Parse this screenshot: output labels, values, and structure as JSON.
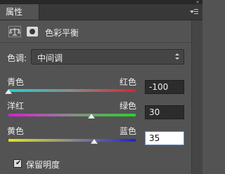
{
  "panel": {
    "tab_label": "属性",
    "collapse_glyph": "«"
  },
  "header": {
    "title": "色彩平衡",
    "adjustment_icon": "balance-scale-icon",
    "mask_icon": "layer-mask-icon"
  },
  "tone": {
    "label": "色调:",
    "value": "中间调"
  },
  "sliders": [
    {
      "left_label": "青色",
      "right_label": "红色",
      "value": "-100",
      "level": -100
    },
    {
      "left_label": "洋红",
      "right_label": "绿色",
      "value": "30",
      "level": 30
    },
    {
      "left_label": "黄色",
      "right_label": "蓝色",
      "value": "35",
      "level": 35
    }
  ],
  "preserve": {
    "label": "保留明度",
    "checked": true
  },
  "colors": {
    "panel_bg": "#535353",
    "cyan": "#1fd3d0",
    "red": "#d9232f",
    "magenta": "#d51fd5",
    "green": "#27d22a",
    "yellow": "#e4e41e",
    "blue": "#1f23d2"
  }
}
